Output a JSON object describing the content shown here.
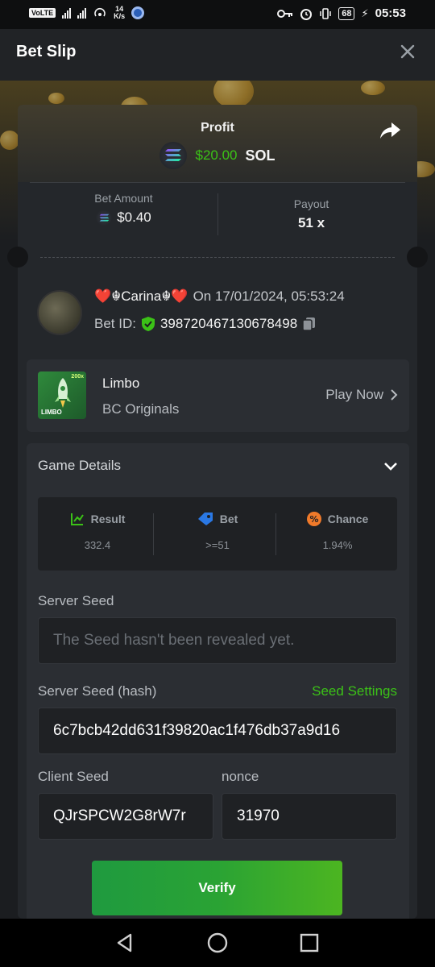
{
  "status_bar": {
    "volte": "VoLTE",
    "net_speed_value": "14",
    "net_speed_unit": "K/s",
    "battery": "68",
    "time": "05:53"
  },
  "header": {
    "title": "Bet Slip"
  },
  "profit": {
    "label": "Profit",
    "amount": "$20.00",
    "currency": "SOL"
  },
  "bet_amount": {
    "label": "Bet Amount",
    "value": "$0.40"
  },
  "payout": {
    "label": "Payout",
    "value": "51 x"
  },
  "user": {
    "name": "❤️☬Carina☬❤️",
    "date": "On 17/01/2024, 05:53:24",
    "bet_id_label": "Bet ID:",
    "bet_id": "398720467130678498"
  },
  "game": {
    "name": "Limbo",
    "provider": "BC Originals",
    "play_now": "Play Now",
    "thumb_text": "LIMBO",
    "thumb_badge": "200x"
  },
  "game_details": {
    "title": "Game Details",
    "stats": [
      {
        "label": "Result",
        "value": "332.4"
      },
      {
        "label": "Bet",
        "value": ">=51"
      },
      {
        "label": "Chance",
        "value": "1.94%"
      }
    ],
    "server_seed_label": "Server Seed",
    "server_seed_placeholder": "The Seed hasn't been revealed yet.",
    "server_seed_hash_label": "Server Seed (hash)",
    "seed_settings": "Seed Settings",
    "server_seed_hash": "6c7bcb42dd631f39820ac1f476db37a9d16",
    "client_seed_label": "Client Seed",
    "client_seed": "QJrSPCW2G8rW7r",
    "nonce_label": "nonce",
    "nonce": "31970",
    "verify_label": "Verify"
  },
  "colors": {
    "accent_green": "#3bc117",
    "card_bg": "#24272b",
    "header_bg": "#212326"
  }
}
